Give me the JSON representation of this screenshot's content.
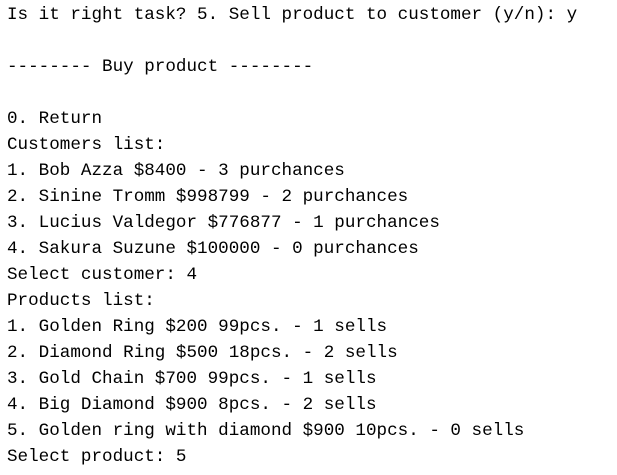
{
  "console": {
    "lines": [
      "Is it right task? 5. Sell product to customer (y/n): y",
      "",
      "-------- Buy product --------",
      "",
      "0. Return",
      "Customers list:",
      "1. Bob Azza $8400 - 3 purchances",
      "2. Sinine Tromm $998799 - 2 purchances",
      "3. Lucius Valdegor $776877 - 1 purchances",
      "4. Sakura Suzune $100000 - 0 purchances",
      "Select customer: 4",
      "Products list:",
      "1. Golden Ring $200 99pcs. - 1 sells",
      "2. Diamond Ring $500 18pcs. - 2 sells",
      "3. Gold Chain $700 99pcs. - 1 sells",
      "4. Big Diamond $900 8pcs. - 2 sells",
      "5. Golden ring with diamond $900 10pcs. - 0 sells",
      "Select product: 5"
    ]
  }
}
